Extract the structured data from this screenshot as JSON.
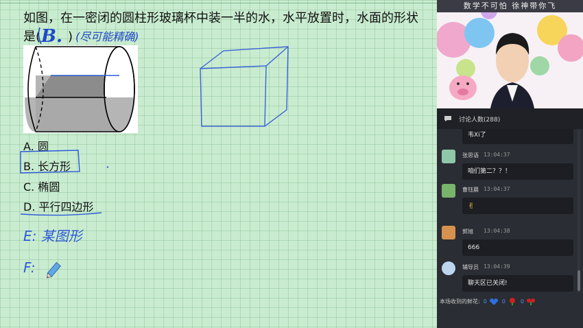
{
  "question": {
    "line1": "如图，在一密闭的圆柱形玻璃杯中装一半的水，水平放置时，水面的形状",
    "line2_prefix": "是(",
    "line2_suffix": ")",
    "handwritten_answer": "B.",
    "handwritten_note": "(尽可能精确)"
  },
  "options": [
    {
      "label": "A. 圆"
    },
    {
      "label": "B. 长方形"
    },
    {
      "label": "C. 椭圆"
    },
    {
      "label": "D. 平行四边形"
    }
  ],
  "handwriting": {
    "extra_e": "E: 某图形",
    "extra_f": "F:"
  },
  "video": {
    "banner": "数学不可怕  徐神带你飞"
  },
  "chat": {
    "header": "讨论人数(288)",
    "partial_top": "韦Xi了",
    "messages": [
      {
        "name": "张思语",
        "time": "13:04:37",
        "text": "咱们第二？？！",
        "avatar_color": "#8fc7a8"
      },
      {
        "name": "曹钰晨",
        "time": "13:04:37",
        "text": "✌",
        "avatar_color": "#79b46b"
      },
      {
        "name": "郭旭",
        "time": "13:04:38",
        "text": "666",
        "avatar_color": "#d6914f"
      },
      {
        "name": "辅导员",
        "time": "13:04:39",
        "text": "聊天区已关闭!",
        "avatar_color": "#bcd6ee"
      }
    ]
  },
  "flowers": {
    "label": "本场收到的鲜花:",
    "counts": [
      "0",
      "0",
      "0"
    ],
    "colors": [
      "#2f6fe0",
      "#d02020",
      "#d02020"
    ]
  }
}
